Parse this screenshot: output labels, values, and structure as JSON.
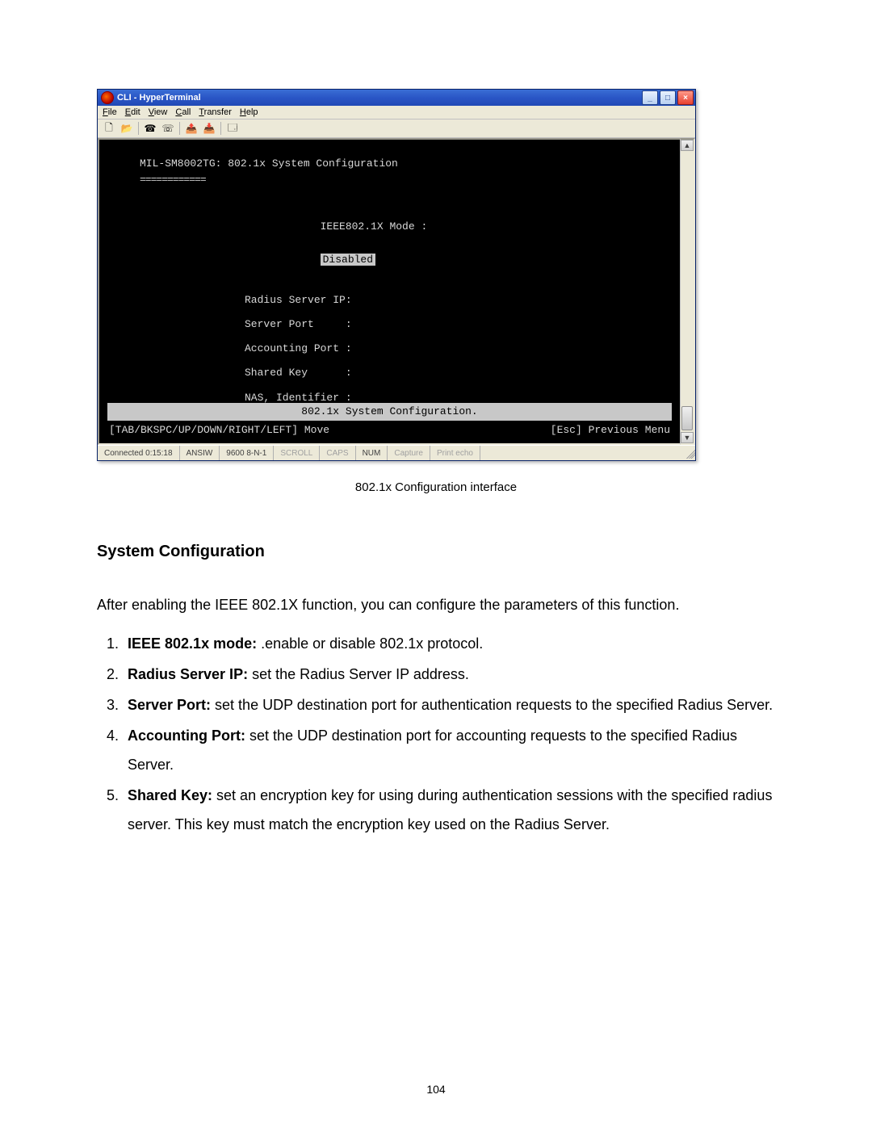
{
  "window": {
    "title": "CLI - HyperTerminal",
    "min_label": "_",
    "max_label": "□",
    "close_label": "×"
  },
  "menu": {
    "file": "File",
    "edit": "Edit",
    "view": "View",
    "call": "Call",
    "transfer": "Transfer",
    "help": "Help"
  },
  "toolbar_icons": {
    "new": "🗋",
    "open": "📂",
    "call": "☎",
    "hangup": "☏",
    "send": "📤",
    "receive": "📥",
    "props": "🗔"
  },
  "terminal": {
    "header": "MIL-SM8002TG: 802.1x System Configuration",
    "rule": "============",
    "fields": {
      "mode_label": "IEEE802.1X Mode :",
      "mode_value": "Disabled",
      "rs_ip_label": "Radius Server IP:",
      "sport_label": "Server Port     :",
      "aport_label": "Accounting Port :",
      "skey_label": "Shared Key      :",
      "nas_label": "NAS, Identifier :"
    },
    "footer_bar": "802.1x System Configuration.",
    "footer_left": "[TAB/BKSPC/UP/DOWN/RIGHT/LEFT] Move",
    "footer_right": "[Esc] Previous Menu"
  },
  "status": {
    "connected": "Connected 0:15:18",
    "emu": "ANSIW",
    "port": "9600 8-N-1",
    "scroll": "SCROLL",
    "caps": "CAPS",
    "num": "NUM",
    "capture": "Capture",
    "printecho": "Print echo"
  },
  "doc": {
    "caption": "802.1x Configuration interface",
    "section": "System Configuration",
    "intro": "After enabling the IEEE 802.1X function, you can configure the parameters of this function.",
    "items": [
      {
        "b": "IEEE 802.1x mode:",
        "t": " .enable or disable 802.1x protocol."
      },
      {
        "b": "Radius Server IP:",
        "t": " set the Radius Server IP address."
      },
      {
        "b": "Server Port:",
        "t": " set the UDP destination port for authentication requests to the specified Radius Server."
      },
      {
        "b": "Accounting Port:",
        "t": " set the UDP destination port for accounting requests to the specified Radius Server."
      },
      {
        "b": "Shared Key:",
        "t": " set an encryption key for using during authentication sessions with the specified radius server. This key must match the encryption key used on the Radius Server."
      }
    ],
    "page_number": "104"
  }
}
